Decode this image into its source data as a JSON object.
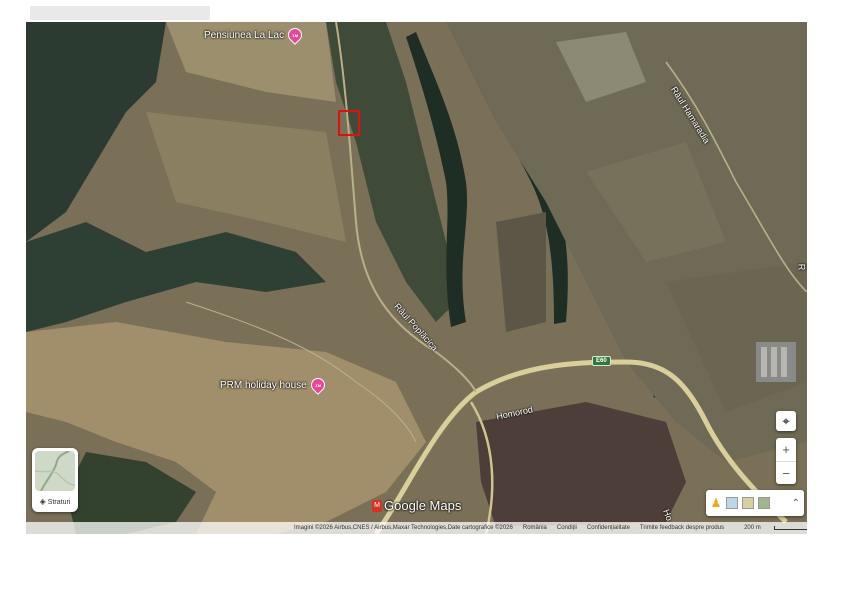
{
  "places": {
    "pensiune": {
      "label": "Pensiunea La Lac",
      "pin_text": "ΣΜ"
    },
    "prm": {
      "label": "PRM holiday house",
      "pin_text": "ΣΜ"
    }
  },
  "roads": {
    "paul_poplaca": "Râul Poplăcica",
    "raul_hamaradia": "Râul Hamaradia",
    "homorod": "Homorod",
    "route_shield": "E60",
    "hom_partial": "Ho",
    "right_edge_partial": "R"
  },
  "controls": {
    "layers_label": "Straturi",
    "zoom_in": "+",
    "zoom_out": "−",
    "locate": "⌖",
    "expand": "⌃"
  },
  "branding": {
    "logo_text": "Google Maps",
    "logo_badge": "M"
  },
  "attribution": {
    "imagery": "Imagini ©2026 Airbus,CNES / Airbus,Maxar Technologies,Date cartografice ©2026",
    "country": "România",
    "terms": "Condiții",
    "privacy": "Confidențialitate",
    "feedback": "Trimite feedback despre produs",
    "scale": "200 m"
  },
  "colors": {
    "pin": "#e8489a",
    "marker": "#e01010",
    "road": "#d9cf9a",
    "forest": "#2b3a2e",
    "field": "#7d745c"
  }
}
